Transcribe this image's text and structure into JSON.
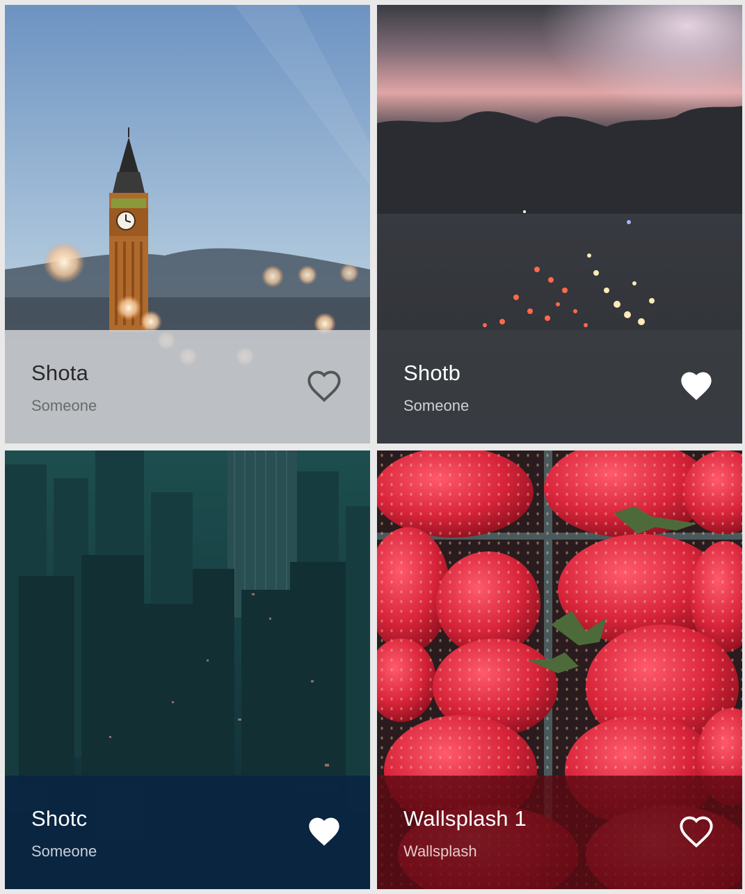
{
  "cards": [
    {
      "title": "Shota",
      "subtitle": "Someone",
      "favorite": false,
      "scene": "clock-tower",
      "footer_color": "#d6d7db",
      "footer_opacity": 0.82,
      "text_color": "#2a2a2a",
      "subtitle_color": "#6a6a6a",
      "icon_color": "#555555"
    },
    {
      "title": "Shotb",
      "subtitle": "Someone",
      "favorite": true,
      "scene": "night-traffic",
      "footer_color": "#3a3d42",
      "footer_opacity": 0.9,
      "text_color": "#ffffff",
      "subtitle_color": "#cfd1d4",
      "icon_color": "#ffffff"
    },
    {
      "title": "Shotc",
      "subtitle": "Someone",
      "favorite": true,
      "scene": "city-aerial",
      "footer_color": "#0a2540",
      "footer_opacity": 0.95,
      "text_color": "#ffffff",
      "subtitle_color": "#c8d0da",
      "icon_color": "#ffffff"
    },
    {
      "title": "Wallsplash 1",
      "subtitle": "Wallsplash",
      "favorite": false,
      "scene": "strawberries",
      "footer_color": "#5c0a12",
      "footer_opacity": 0.82,
      "text_color": "#ffffff",
      "subtitle_color": "#e7c9cc",
      "icon_color": "#ffffff"
    }
  ]
}
